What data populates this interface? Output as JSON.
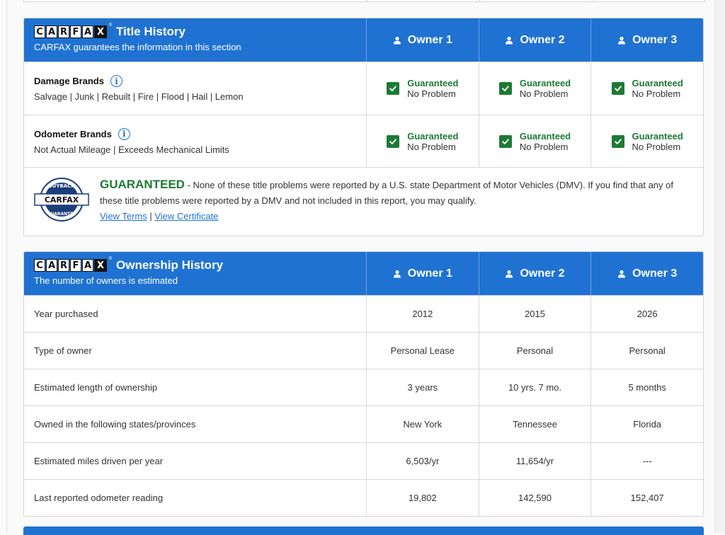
{
  "brand": {
    "logo_letters": [
      "C",
      "A",
      "R",
      "F",
      "A",
      "X"
    ],
    "trademark": "®",
    "accent_color": "#1f72d1",
    "guarantee_color": "#1d7a35"
  },
  "title_history": {
    "title": "Title History",
    "subtitle": "CARFAX guarantees the information in this section",
    "owners": [
      "Owner 1",
      "Owner 2",
      "Owner 3"
    ],
    "rows": [
      {
        "name": "Damage Brands",
        "details": "Salvage | Junk | Rebuilt | Fire | Flood | Hail | Lemon",
        "values": [
          {
            "status": "Guaranteed",
            "result": "No Problem"
          },
          {
            "status": "Guaranteed",
            "result": "No Problem"
          },
          {
            "status": "Guaranteed",
            "result": "No Problem"
          }
        ]
      },
      {
        "name": "Odometer Brands",
        "details": "Not Actual Mileage | Exceeds Mechanical Limits",
        "values": [
          {
            "status": "Guaranteed",
            "result": "No Problem"
          },
          {
            "status": "Guaranteed",
            "result": "No Problem"
          },
          {
            "status": "Guaranteed",
            "result": "No Problem"
          }
        ]
      }
    ],
    "guarantee": {
      "seal_top": "BUYBACK",
      "seal_bottom": "GUARANTEE",
      "heading": "GUARANTEED",
      "text": " - None of these title problems were reported by a U.S. state Department of Motor Vehicles (DMV). If you find that any of these title problems were reported by a DMV and not included in this report, you may qualify.",
      "view_terms": "View Terms",
      "separator": " | ",
      "view_certificate": "View Certificate"
    }
  },
  "ownership_history": {
    "title": "Ownership History",
    "subtitle": "The number of owners is estimated",
    "owners": [
      "Owner 1",
      "Owner 2",
      "Owner 3"
    ],
    "rows": [
      {
        "label": "Year purchased",
        "values": [
          "2012",
          "2015",
          "2026"
        ]
      },
      {
        "label": "Type of owner",
        "values": [
          "Personal Lease",
          "Personal",
          "Personal"
        ]
      },
      {
        "label": "Estimated length of ownership",
        "values": [
          "3 years",
          "10 yrs. 7 mo.",
          "5 months"
        ]
      },
      {
        "label": "Owned in the following states/provinces",
        "values": [
          "New York",
          "Tennessee",
          "Florida"
        ]
      },
      {
        "label": "Estimated miles driven per year",
        "values": [
          "6,503/yr",
          "11,654/yr",
          "---"
        ]
      },
      {
        "label": "Last reported odometer reading",
        "values": [
          "19,802",
          "142,590",
          "152,407"
        ]
      }
    ]
  }
}
